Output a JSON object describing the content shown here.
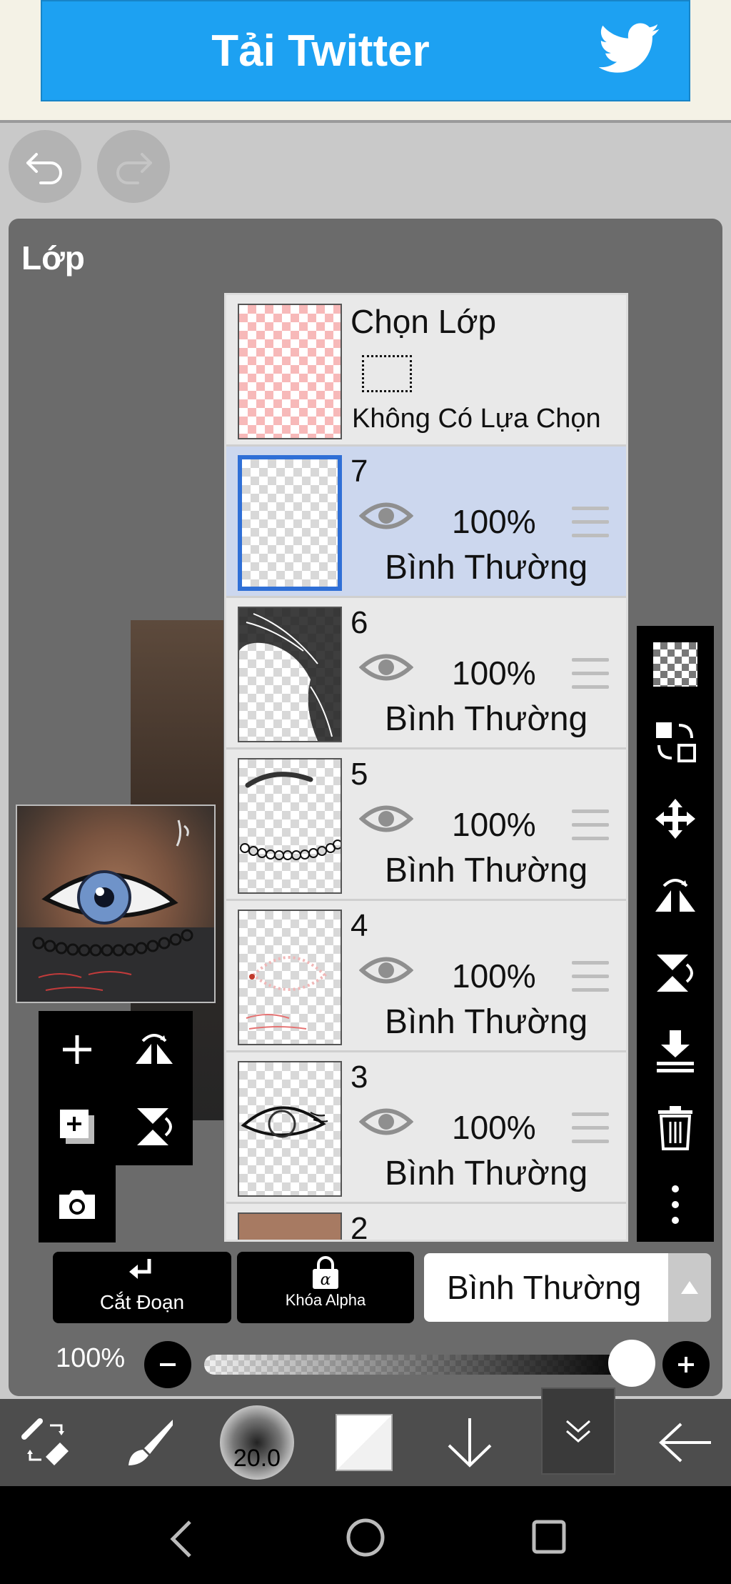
{
  "ad": {
    "text": "Tải Twitter"
  },
  "panel": {
    "title": "Lớp"
  },
  "selection_layer": {
    "title": "Chọn Lớp",
    "status": "Không Có Lựa Chọn"
  },
  "layers": [
    {
      "number": "7",
      "opacity": "100%",
      "blend": "Bình Thường",
      "selected": true
    },
    {
      "number": "6",
      "opacity": "100%",
      "blend": "Bình Thường"
    },
    {
      "number": "5",
      "opacity": "100%",
      "blend": "Bình Thường"
    },
    {
      "number": "4",
      "opacity": "100%",
      "blend": "Bình Thường"
    },
    {
      "number": "3",
      "opacity": "100%",
      "blend": "Bình Thường"
    },
    {
      "number": "2"
    }
  ],
  "buttons": {
    "clipping": "Cắt Đoạn",
    "alpha_lock": "Khóa Alpha",
    "blend_mode": "Bình Thường"
  },
  "opacity": {
    "label": "100%",
    "value": 1.0
  },
  "toolbar": {
    "brush_size": "20.0"
  },
  "colors": {
    "accent": "#1da1f2",
    "selected_row": "#ccd7ee",
    "selection_border": "#2f6fd6"
  },
  "icons": {
    "top": [
      "undo-icon",
      "redo-icon"
    ],
    "left_tools": [
      "add-layer-icon",
      "flip-horizontal-icon",
      "duplicate-layer-icon",
      "flip-vertical-icon",
      "camera-icon"
    ],
    "right_tools": [
      "transparency-icon",
      "select-layer-icon",
      "move-icon",
      "flip-h-icon",
      "flip-v-icon",
      "merge-down-icon",
      "trash-icon",
      "more-icon"
    ],
    "bottom": [
      "tool-switch-icon",
      "brush-icon",
      "brush-size",
      "color-swatch",
      "arrow-down-icon",
      "chevron-double-down-icon",
      "back-arrow-icon"
    ],
    "nav": [
      "nav-back-icon",
      "nav-home-icon",
      "nav-recents-icon"
    ]
  }
}
